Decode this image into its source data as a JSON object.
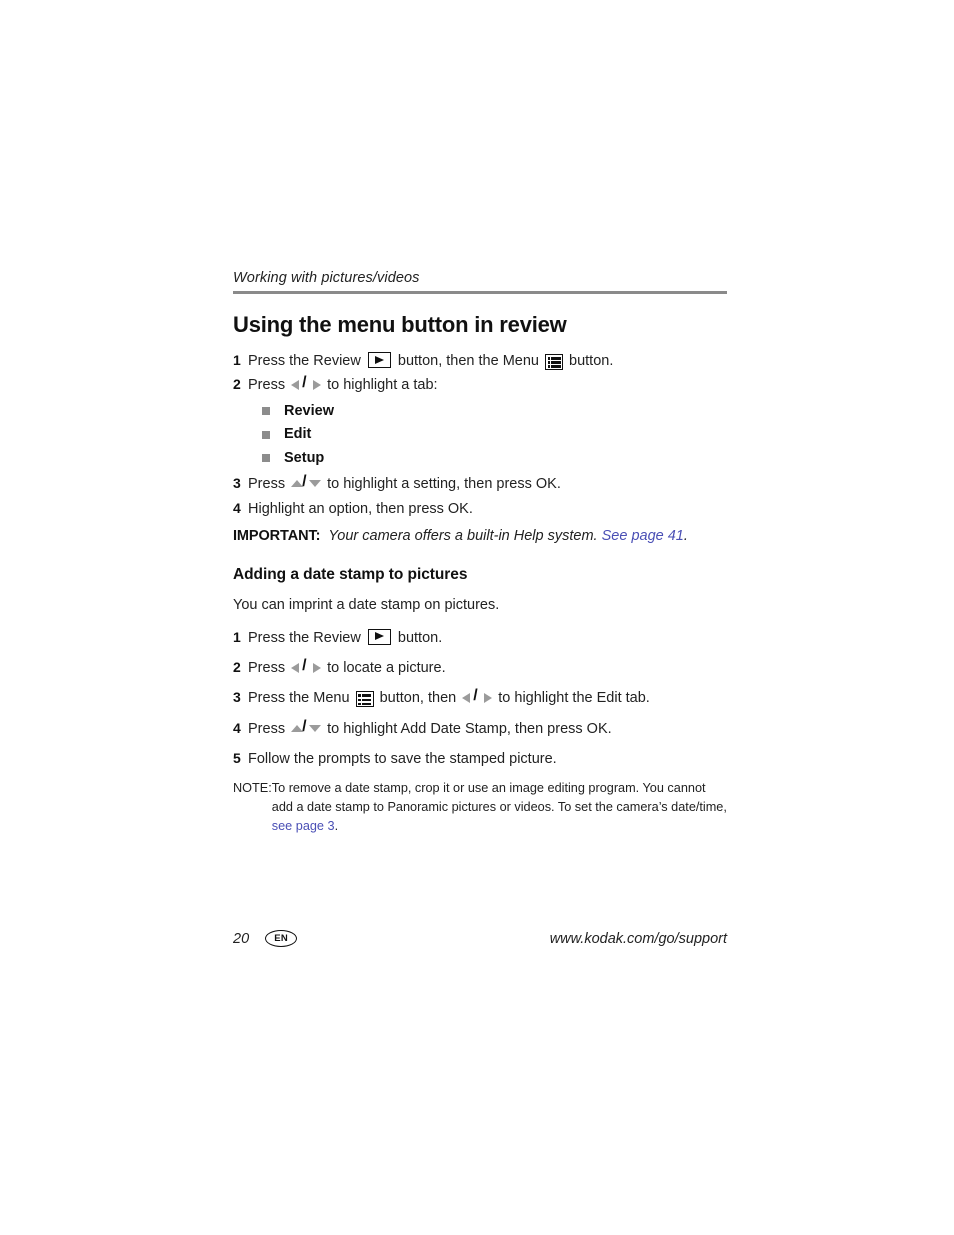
{
  "running_header": "Working with pictures/videos",
  "sections": [
    {
      "title": "Using the menu button in review",
      "steps": [
        {
          "num": "1",
          "parts": [
            {
              "t": "text",
              "v": "Press the Review "
            },
            {
              "t": "icon",
              "v": "review-button-icon"
            },
            {
              "t": "text",
              "v": " button, then the Menu "
            },
            {
              "t": "icon",
              "v": "menu-button-icon"
            },
            {
              "t": "text",
              "v": " button."
            }
          ]
        },
        {
          "num": "2",
          "parts": [
            {
              "t": "text",
              "v": "Press "
            },
            {
              "t": "icon",
              "v": "left-right-arrows-icon"
            },
            {
              "t": "text",
              "v": " to highlight a tab:"
            }
          ]
        }
      ],
      "bullets": [
        "Review",
        "Edit",
        "Setup"
      ],
      "steps2": [
        {
          "num": "3",
          "parts": [
            {
              "t": "text",
              "v": "Press "
            },
            {
              "t": "icon",
              "v": "up-down-arrows-icon"
            },
            {
              "t": "text",
              "v": " to highlight a setting, then press OK."
            }
          ]
        },
        {
          "num": "4",
          "parts": [
            {
              "t": "text",
              "v": "Highlight an option, then press OK."
            }
          ]
        }
      ],
      "important": {
        "label": "IMPORTANT:",
        "body": "Your camera offers a built-in Help system. ",
        "link": "See page 41",
        "tail": "."
      }
    },
    {
      "title": "Adding a date stamp to pictures",
      "intro": "You can imprint a date stamp on pictures.",
      "steps": [
        {
          "num": "1",
          "parts": [
            {
              "t": "text",
              "v": "Press the Review "
            },
            {
              "t": "icon",
              "v": "review-button-icon"
            },
            {
              "t": "text",
              "v": " button."
            }
          ]
        },
        {
          "num": "2",
          "parts": [
            {
              "t": "text",
              "v": "Press "
            },
            {
              "t": "icon",
              "v": "left-right-arrows-icon"
            },
            {
              "t": "text",
              "v": " to locate a picture."
            }
          ]
        },
        {
          "num": "3",
          "parts": [
            {
              "t": "text",
              "v": "Press the Menu "
            },
            {
              "t": "icon",
              "v": "menu-button-icon"
            },
            {
              "t": "text",
              "v": " button, then "
            },
            {
              "t": "icon",
              "v": "left-right-arrows-icon"
            },
            {
              "t": "text",
              "v": " to highlight the Edit tab."
            }
          ]
        },
        {
          "num": "4",
          "parts": [
            {
              "t": "text",
              "v": "Press "
            },
            {
              "t": "icon",
              "v": "up-down-arrows-icon"
            },
            {
              "t": "text",
              "v": " to highlight Add Date Stamp, then press OK."
            }
          ]
        },
        {
          "num": "5",
          "parts": [
            {
              "t": "text",
              "v": "Follow the prompts to save the stamped picture."
            }
          ]
        }
      ],
      "note": {
        "label": "NOTE:",
        "body": "To remove a date stamp, crop it or use an image editing program. You cannot add a date stamp to Panoramic pictures or videos. To set the camera’s date/time, ",
        "link": "see page 3",
        "tail": "."
      }
    }
  ],
  "footer": {
    "page_number": "20",
    "language_badge": "EN",
    "url": "www.kodak.com/go/support"
  },
  "colors": {
    "link": "#4a4fb5",
    "rule": "#8a8a8a",
    "bullet": "#8c8c8c",
    "arrow": "#9b9b9b",
    "text": "#222222"
  }
}
